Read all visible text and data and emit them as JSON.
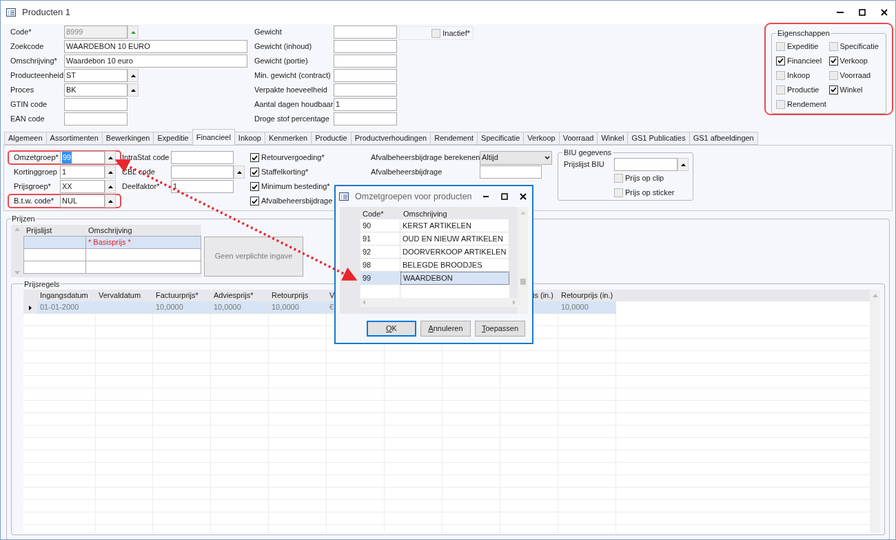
{
  "window": {
    "title": "Producten 1"
  },
  "fields_left": [
    {
      "label": "Code*",
      "value": "8999",
      "kind": "spin",
      "disabled": true
    },
    {
      "label": "Zoekcode",
      "value": "WAARDEBON 10 EURO",
      "kind": "wide",
      "disabled": false
    },
    {
      "label": "Omschrijving*",
      "value": "Waardebon 10 euro",
      "kind": "wide",
      "disabled": false
    },
    {
      "label": "Producteenheid",
      "value": "ST",
      "kind": "lookup",
      "disabled": false
    },
    {
      "label": "Proces",
      "value": "BK",
      "kind": "lookup",
      "disabled": false
    },
    {
      "label": "GTIN code",
      "kind": "short",
      "disabled": false
    },
    {
      "label": "EAN code",
      "kind": "short",
      "disabled": false
    }
  ],
  "fields_right": [
    {
      "label": "Gewicht"
    },
    {
      "label": "Gewicht (inhoud)"
    },
    {
      "label": "Gewicht (portie)"
    },
    {
      "label": "Min. gewicht (contract)"
    },
    {
      "label": "Verpakte hoeveelheid"
    },
    {
      "label": "Aantal dagen houdbaar",
      "value": "1"
    },
    {
      "label": "Droge stof percentage"
    }
  ],
  "inactive": {
    "label": "Inactief*",
    "checked": false
  },
  "properties": {
    "title": "Eigenschappen",
    "items": [
      {
        "label": "Expeditie",
        "checked": false
      },
      {
        "label": "Specificatie",
        "checked": false
      },
      {
        "label": "Financieel",
        "checked": true
      },
      {
        "label": "Verkoop",
        "checked": true
      },
      {
        "label": "Inkoop",
        "checked": false
      },
      {
        "label": "Voorraad",
        "checked": false
      },
      {
        "label": "Productie",
        "checked": false
      },
      {
        "label": "Winkel",
        "checked": true
      },
      {
        "label": "Rendement",
        "checked": false
      }
    ]
  },
  "tabs": [
    {
      "label": "Algemeen",
      "selected": false
    },
    {
      "label": "Assortimenten",
      "selected": false
    },
    {
      "label": "Bewerkingen",
      "selected": false
    },
    {
      "label": "Expeditie",
      "selected": false
    },
    {
      "label": "Financieel",
      "selected": true
    },
    {
      "label": "Inkoop",
      "selected": false
    },
    {
      "label": "Kenmerken",
      "selected": false
    },
    {
      "label": "Productie",
      "selected": false
    },
    {
      "label": "Productverhoudingen",
      "selected": false
    },
    {
      "label": "Rendement",
      "selected": false
    },
    {
      "label": "Specificatie",
      "selected": false
    },
    {
      "label": "Verkoop",
      "selected": false
    },
    {
      "label": "Voorraad",
      "selected": false
    },
    {
      "label": "Winkel",
      "selected": false
    },
    {
      "label": "GS1 Publicaties",
      "selected": false
    },
    {
      "label": "GS1 afbeeldingen",
      "selected": false
    }
  ],
  "financial": {
    "groups": [
      {
        "label": "Omzetgroep*",
        "value": "99",
        "highlighted": true,
        "focused": true
      },
      {
        "label": "Kortinggroep",
        "value": "1",
        "highlighted": false,
        "focused": false
      },
      {
        "label": "Prijsgroep*",
        "value": "XX",
        "highlighted": false,
        "focused": false
      },
      {
        "label": "B.t.w. code*",
        "value": "NUL",
        "highlighted": true,
        "focused": false
      }
    ],
    "codes": [
      {
        "label": "IntraStat code",
        "kind": "text"
      },
      {
        "label": "CBL code",
        "kind": "lookup"
      },
      {
        "label": "Deelfaktor*",
        "value": "1",
        "kind": "text"
      }
    ],
    "options": [
      {
        "label": "Retourvergoeding*",
        "checked": true
      },
      {
        "label": "Staffelkorting*",
        "checked": true
      },
      {
        "label": "Minimum besteding*",
        "checked": true
      },
      {
        "label": "Afvalbeheersbijdrage",
        "checked": true
      }
    ],
    "waste_calc": {
      "label": "Afvalbeheersbijdrage berekenen",
      "value": "Altijd"
    },
    "waste_fee": {
      "label": "Afvalbeheersbijdrage"
    },
    "biu": {
      "title": "BIU gegevens",
      "pricelist_label": "Prijslijst BIU",
      "options": [
        {
          "label": "Prijs op clip",
          "checked": false
        },
        {
          "label": "Prijs op sticker",
          "checked": false
        }
      ]
    }
  },
  "prices": {
    "title": "Prijzen",
    "columns": [
      "Prijslijst",
      "Omschrijving"
    ],
    "rows": [
      {
        "selected": true,
        "cells": [
          null,
          "* Basisprijs *"
        ]
      },
      {
        "selected": false,
        "cells": [
          null,
          null
        ]
      },
      {
        "selected": false,
        "cells": [
          null,
          null
        ]
      }
    ],
    "button": {
      "label": "Geen verplichte ingave",
      "disabled": true
    }
  },
  "price_rules": {
    "title": "Prijsregels",
    "columns": [
      "Ingangsdatum",
      "Vervaldatum",
      "Factuurprijs*",
      "Adviesprijs*",
      "Retourprijs",
      "V",
      null,
      null,
      "is (in.)",
      "Retourprijs (in.)"
    ],
    "rows": [
      {
        "current": true,
        "cells": [
          "01-01-2000",
          null,
          "10,0000",
          "10,0000",
          "10,0000",
          "€",
          null,
          null,
          null,
          "10,0000"
        ]
      }
    ]
  },
  "dialog": {
    "title": "Omzetgroepen voor producten",
    "columns": [
      "Code*",
      "Omschrijving"
    ],
    "rows": [
      {
        "code": "90",
        "name": "KERST ARTIKELEN",
        "selected": false
      },
      {
        "code": "91",
        "name": "OUD EN NIEUW ARTIKELEN",
        "selected": false
      },
      {
        "code": "92",
        "name": "DOORVERKOOP ARTIKELEN",
        "selected": false
      },
      {
        "code": "98",
        "name": "BELEGDE BROODJES",
        "selected": false
      },
      {
        "code": "99",
        "name": "WAARDEBON",
        "selected": true
      }
    ],
    "buttons": [
      {
        "label": "OK",
        "default": true
      },
      {
        "label": "Annuleren",
        "default": false
      },
      {
        "label": "Toepassen",
        "default": false
      }
    ]
  }
}
